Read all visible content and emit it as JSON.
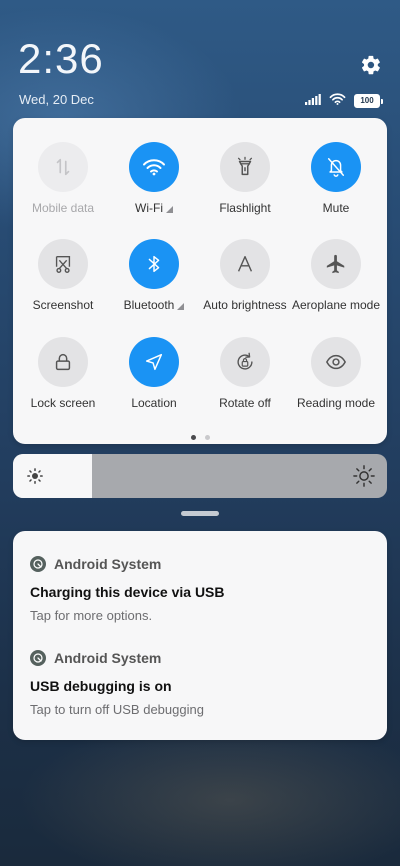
{
  "status": {
    "time": "2:36",
    "date": "Wed, 20 Dec",
    "battery": "100",
    "icons": [
      "signal-icon",
      "wifi-icon",
      "battery-icon"
    ]
  },
  "quick_settings": {
    "tiles": [
      {
        "label": "Mobile data",
        "icon": "mobile-data-icon",
        "state": "disabled"
      },
      {
        "label": "Wi-Fi",
        "icon": "wifi-icon",
        "state": "on",
        "has_arrow": true
      },
      {
        "label": "Flashlight",
        "icon": "flashlight-icon",
        "state": "off"
      },
      {
        "label": "Mute",
        "icon": "bell-off-icon",
        "state": "on"
      },
      {
        "label": "Screenshot",
        "icon": "screenshot-icon",
        "state": "off"
      },
      {
        "label": "Bluetooth",
        "icon": "bluetooth-icon",
        "state": "on",
        "has_arrow": true
      },
      {
        "label": "Auto brightness",
        "icon": "auto-brightness-icon",
        "state": "off"
      },
      {
        "label": "Aeroplane mode",
        "icon": "airplane-icon",
        "state": "off"
      },
      {
        "label": "Lock screen",
        "icon": "lock-icon",
        "state": "off"
      },
      {
        "label": "Location",
        "icon": "location-icon",
        "state": "on"
      },
      {
        "label": "Rotate off",
        "icon": "rotate-lock-icon",
        "state": "off"
      },
      {
        "label": "Reading mode",
        "icon": "eye-icon",
        "state": "off"
      }
    ],
    "pages": {
      "total": 2,
      "current": 1
    }
  },
  "brightness": {
    "level": 0.21
  },
  "notifications": [
    {
      "app": "Android System",
      "title": "Charging this device via USB",
      "text": "Tap for more options."
    },
    {
      "app": "Android System",
      "title": "USB debugging is on",
      "text": "Tap to turn off USB debugging"
    }
  ],
  "colors": {
    "accent": "#1a93f4",
    "tile_off": "#e3e3e5",
    "panel": "#f7f7f8"
  }
}
